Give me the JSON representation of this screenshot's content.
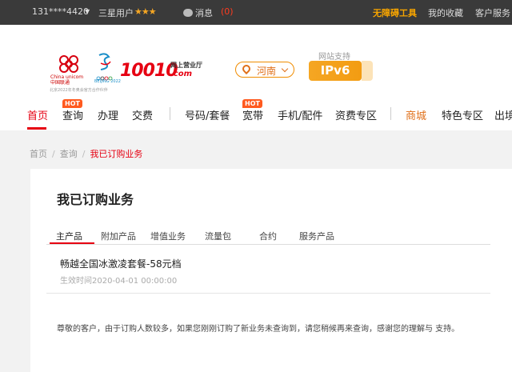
{
  "topbar": {
    "phone": "131****4420",
    "dropdown_icon": "caret-down-icon",
    "user_level": "三星用户",
    "stars": "★★★",
    "message_label": "消息",
    "message_count": "(0)",
    "links": [
      "无障碍工具",
      "我的收藏",
      "客户服务"
    ]
  },
  "logo": {
    "brand_cn": "中国联通",
    "brand_en": "China unicom",
    "olympics": "BEIJING 2022",
    "sub": "北京2022年冬奥会官方合作伙伴",
    "hotline": "10010",
    "hall": "网上营业厅",
    "domain": ".com"
  },
  "region": {
    "label": "河南"
  },
  "ipv6": {
    "caption": "网站支持",
    "label": "IPv6"
  },
  "nav": {
    "items": [
      "首页",
      "查询",
      "办理",
      "交费",
      "号码/套餐",
      "宽带",
      "手机/配件",
      "资费专区",
      "商城",
      "特色专区",
      "出境"
    ],
    "hot_label": "HOT"
  },
  "breadcrumb": {
    "items": [
      "首页",
      "查询",
      "我已订购业务"
    ],
    "separator": "/"
  },
  "panel": {
    "title": "我已订购业务",
    "tabs": [
      "主产品",
      "附加产品",
      "增值业务",
      "流量包",
      "合约",
      "服务产品"
    ],
    "plan_name": "畅越全国冰激凌套餐-58元档",
    "plan_date": "生效时间2020-04-01 00:00:00",
    "notice": "尊敬的客户，由于订购人数较多，如果您刚刚订购了新业务未查询到，请您稍候再来查询，感谢您的理解与 支持。"
  },
  "colors": {
    "brand_red": "#e60012",
    "accent_orange": "#f6a400"
  }
}
